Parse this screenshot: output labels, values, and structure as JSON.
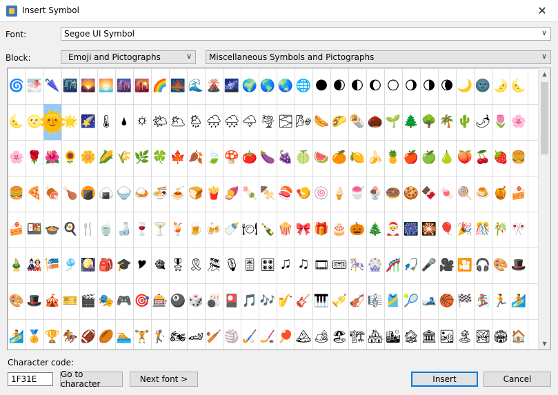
{
  "window": {
    "title": "Insert Symbol",
    "close_glyph": "✕"
  },
  "font": {
    "label": "Font:",
    "value": "Segoe UI Symbol"
  },
  "block": {
    "label": "Block:",
    "category": "Emoji and Pictographs",
    "subblock": "Miscellaneous Symbols and Pictographs"
  },
  "grid": {
    "selected_row": 1,
    "selected_col": 2,
    "rows": [
      [
        "🌀",
        "🌁",
        "🌂",
        "🌃",
        "🌄",
        "🌅",
        "🌆",
        "🌇",
        "🌈",
        "🌉",
        "🌊",
        "🌋",
        "🌌",
        "🌍",
        "🌎",
        "🌏",
        "🌐",
        "🌑",
        "🌒",
        "🌓",
        "🌔",
        "🌕",
        "🌖",
        "🌗",
        "🌘",
        "🌙",
        "🌚",
        "🌛",
        "🌜"
      ],
      [
        "🌜",
        "🌝",
        "🌞",
        "🌟",
        "🌠",
        "🌡",
        "🌢",
        "🌣",
        "🌤",
        "🌥",
        "🌦",
        "🌧",
        "🌨",
        "🌩",
        "🌪",
        "🌫",
        "🌬",
        "🌭",
        "🌮",
        "🌯",
        "🌰",
        "🌱",
        "🌲",
        "🌳",
        "🌴",
        "🌵",
        "🌶",
        "🌷",
        "🌸"
      ],
      [
        "🌸",
        "🌹",
        "🌺",
        "🌻",
        "🌼",
        "🌽",
        "🌾",
        "🌿",
        "🍀",
        "🍁",
        "🍂",
        "🍃",
        "🍄",
        "🍅",
        "🍆",
        "🍇",
        "🍈",
        "🍉",
        "🍊",
        "🍋",
        "🍌",
        "🍍",
        "🍎",
        "🍏",
        "🍐",
        "🍑",
        "🍒",
        "🍓",
        "🍔"
      ],
      [
        "🍔",
        "🍕",
        "🍖",
        "🍗",
        "🍘",
        "🍙",
        "🍚",
        "🍛",
        "🍜",
        "🍝",
        "🍞",
        "🍟",
        "🍠",
        "🍡",
        "🍢",
        "🍣",
        "🍤",
        "🍥",
        "🍦",
        "🍧",
        "🍨",
        "🍩",
        "🍪",
        "🍫",
        "🍬",
        "🍭",
        "🍮",
        "🍯",
        "🍰"
      ],
      [
        "🍰",
        "🍱",
        "🍲",
        "🍳",
        "🍴",
        "🍵",
        "🍶",
        "🍷",
        "🍸",
        "🍹",
        "🍺",
        "🍻",
        "🍼",
        "🍽",
        "🍾",
        "🍿",
        "🎀",
        "🎁",
        "🎂",
        "🎃",
        "🎄",
        "🎅",
        "🎆",
        "🎇",
        "🎈",
        "🎉",
        "🎊",
        "🎋",
        "🎌"
      ],
      [
        "🎍",
        "🎎",
        "🎏",
        "🎐",
        "🎑",
        "🎒",
        "🎓",
        "🎔",
        "🎕",
        "🎖",
        "🎗",
        "🎘",
        "🎙",
        "🎚",
        "🎛",
        "🎜",
        "🎝",
        "🎞",
        "🎟",
        "🎠",
        "🎡",
        "🎢",
        "🎣",
        "🎤",
        "🎥",
        "🎦",
        "🎧",
        "🎨",
        "🎩"
      ],
      [
        "🎨",
        "🎩",
        "🎪",
        "🎫",
        "🎬",
        "🎭",
        "🎮",
        "🎯",
        "🎰",
        "🎱",
        "🎲",
        "🎳",
        "🎴",
        "🎵",
        "🎶",
        "🎷",
        "🎸",
        "🎹",
        "🎺",
        "🎻",
        "🎼",
        "🎽",
        "🎾",
        "🎿",
        "🏀",
        "🏁",
        "🏂",
        "🏃",
        "🏄"
      ],
      [
        "🏄",
        "🏅",
        "🏆",
        "🏇",
        "🏈",
        "🏉",
        "🏊",
        "🏋",
        "🏌",
        "🏍",
        "🏎",
        "🏏",
        "🏐",
        "🏑",
        "🏒",
        "🏓",
        "🏔",
        "🏕",
        "🏖",
        "🏗",
        "🏘",
        "🏙",
        "🏚",
        "🏛",
        "🏜",
        "🏝",
        "🏞",
        "🏟",
        "🏠"
      ]
    ]
  },
  "charcode": {
    "label": "Character code:",
    "value": "1F31E"
  },
  "buttons": {
    "goto": "Go to character",
    "next_font": "Next font >",
    "insert": "Insert",
    "cancel": "Cancel"
  },
  "icons": {
    "app": "app-icon",
    "dropdown": "chevron-down-icon",
    "scroll_up": "scroll-up-arrow",
    "scroll_down": "scroll-down-arrow"
  }
}
